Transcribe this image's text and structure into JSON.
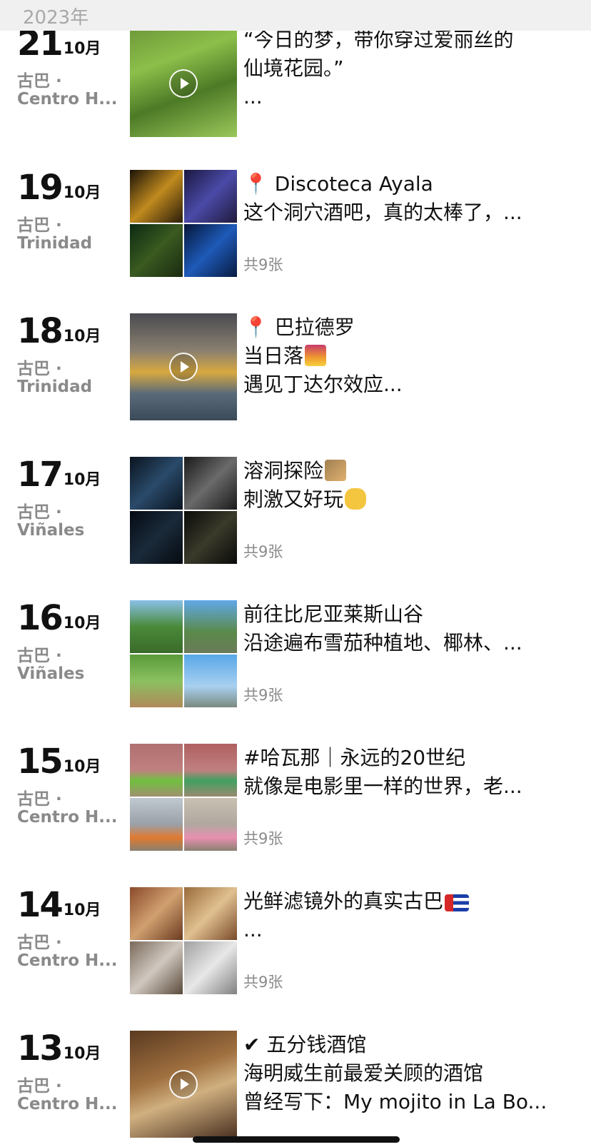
{
  "year_header": "2023年",
  "entries": [
    {
      "day": "21",
      "month": "10月",
      "loc1": "古巴 ·",
      "loc2": "Centro H...",
      "lines": [
        "“今日的梦，带你穿过爱丽丝的",
        "仙境花园。”",
        "..."
      ],
      "count": "",
      "media": "video"
    },
    {
      "day": "19",
      "month": "10月",
      "loc1": "古巴 ·",
      "loc2": "Trinidad",
      "lines": [
        "Discoteca Ayala",
        "这个洞穴酒吧，真的太棒了，...",
        ""
      ],
      "count": "共9张",
      "media": "grid"
    },
    {
      "day": "18",
      "month": "10月",
      "loc1": "古巴 ·",
      "loc2": "Trinidad",
      "lines": [
        "巴拉德罗",
        "当日落",
        "遇见丁达尔效应..."
      ],
      "count": "",
      "media": "video"
    },
    {
      "day": "17",
      "month": "10月",
      "loc1": "古巴 ·",
      "loc2": "Viñales",
      "lines": [
        "溶洞探险",
        "刺激又好玩",
        ""
      ],
      "count": "共9张",
      "media": "grid"
    },
    {
      "day": "16",
      "month": "10月",
      "loc1": "古巴 ·",
      "loc2": "Viñales",
      "lines": [
        "前往比尼亚莱斯山谷",
        "沿途遍布雪茄种植地、椰林、...",
        ""
      ],
      "count": "共9张",
      "media": "grid"
    },
    {
      "day": "15",
      "month": "10月",
      "loc1": "古巴 ·",
      "loc2": "Centro H...",
      "lines": [
        "#哈瓦那｜永远的20世纪",
        "就像是电影里一样的世界，老...",
        ""
      ],
      "count": "共9张",
      "media": "grid"
    },
    {
      "day": "14",
      "month": "10月",
      "loc1": "古巴 ·",
      "loc2": "Centro H...",
      "lines": [
        "光鲜滤镜外的真实古巴",
        "...",
        ""
      ],
      "count": "共9张",
      "media": "grid"
    },
    {
      "day": "13",
      "month": "10月",
      "loc1": "古巴 ·",
      "loc2": "Centro H...",
      "lines": [
        "五分钱酒馆",
        "海明威生前最爱关顾的酒馆",
        "曾经写下：My mojito in La Bo..."
      ],
      "count": "",
      "media": "video"
    }
  ]
}
